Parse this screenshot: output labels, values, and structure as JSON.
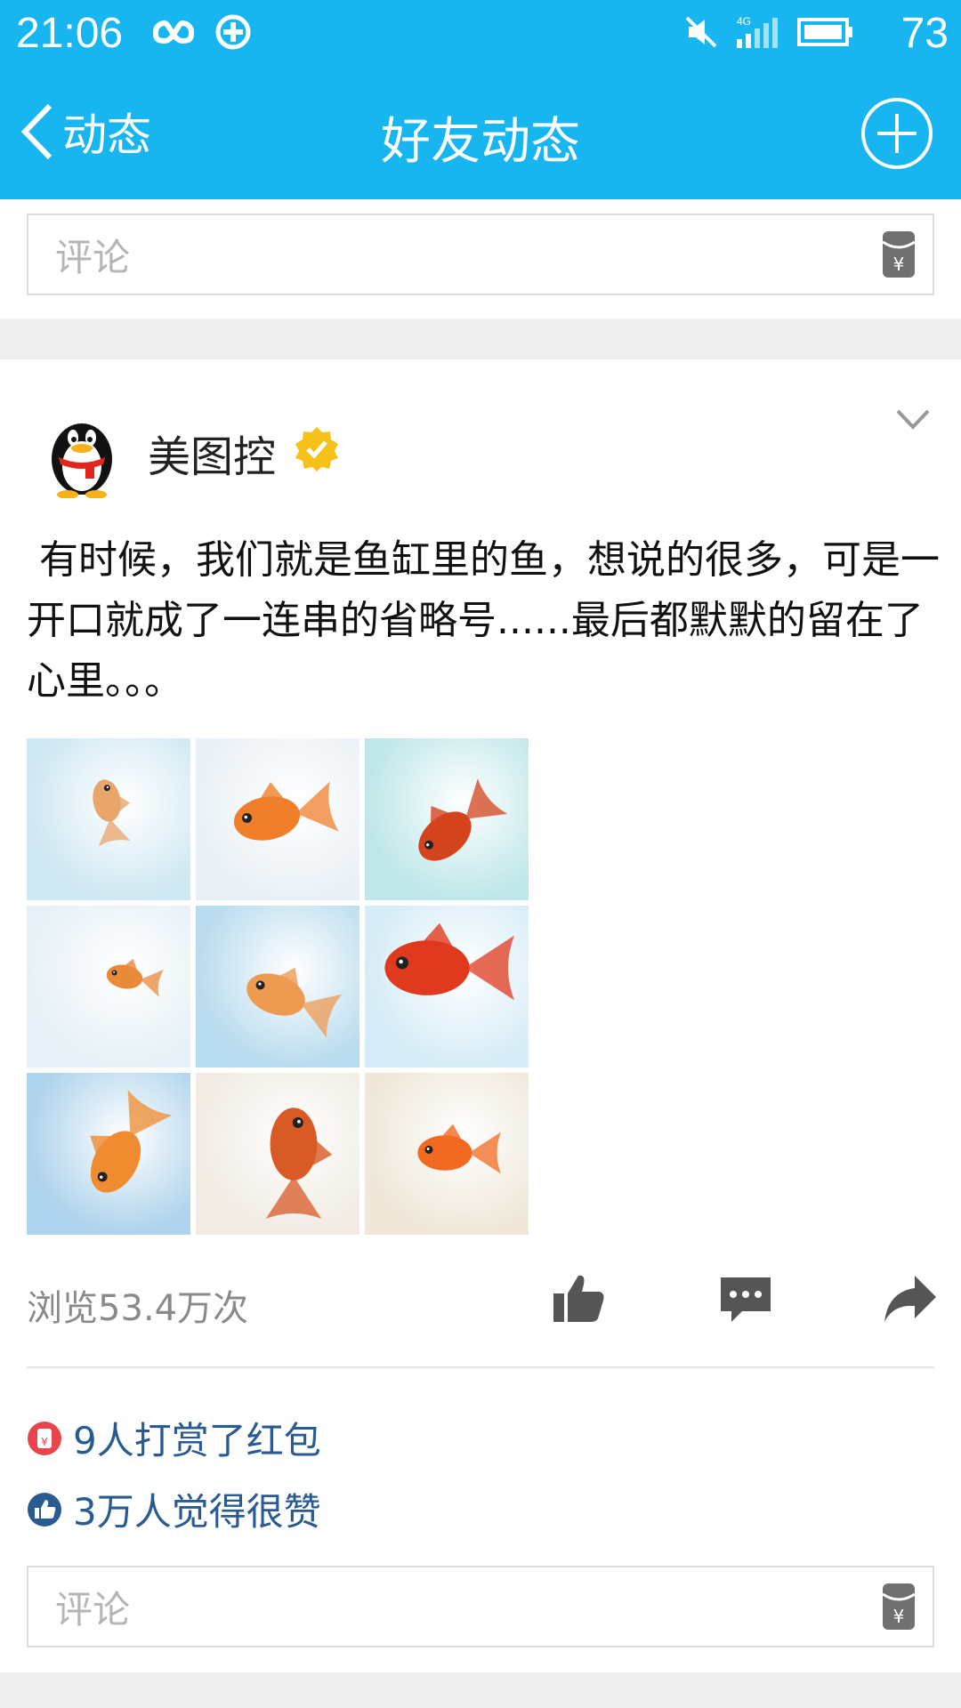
{
  "status_bar": {
    "time": "21:06",
    "battery": "73",
    "network": "4G",
    "icons": [
      "infinity-icon",
      "plus-circle-icon",
      "mute-icon",
      "signal-icon",
      "battery-icon"
    ]
  },
  "nav": {
    "back_label": "动态",
    "title": "好友动态"
  },
  "comment_top": {
    "placeholder": "评论"
  },
  "post": {
    "author": "美图控",
    "text": " 有时候，我们就是鱼缸里的鱼，想说的很多，可是一开口就成了一连串的省略号......最后都默默的留在了心里。。。",
    "images": [
      {
        "bg": "#cfe8f3",
        "fish": "#e9a66a"
      },
      {
        "bg": "#eaf1f6",
        "fish": "#f07f2b"
      },
      {
        "bg": "#bfe7e9",
        "fish": "#d3431d"
      },
      {
        "bg": "#e6f1f7",
        "fish": "#e98a3a"
      },
      {
        "bg": "#b9dcef",
        "fish": "#ee9b52"
      },
      {
        "bg": "#d6ecf7",
        "fish": "#e0391e"
      },
      {
        "bg": "#aed3ec",
        "fish": "#f08b2f"
      },
      {
        "bg": "#f1ebe3",
        "fish": "#d85a25"
      },
      {
        "bg": "#efe8d9",
        "fish": "#f26a22"
      }
    ],
    "views": "浏览53.4万次",
    "redpacket_text": "9人打赏了红包",
    "likes_text": "3万人觉得很赞"
  },
  "comment_bottom": {
    "placeholder": "评论"
  },
  "colors": {
    "header_blue": "#17b6f0",
    "link_blue": "#2a5a92",
    "verified_gold": "#f6c219"
  }
}
